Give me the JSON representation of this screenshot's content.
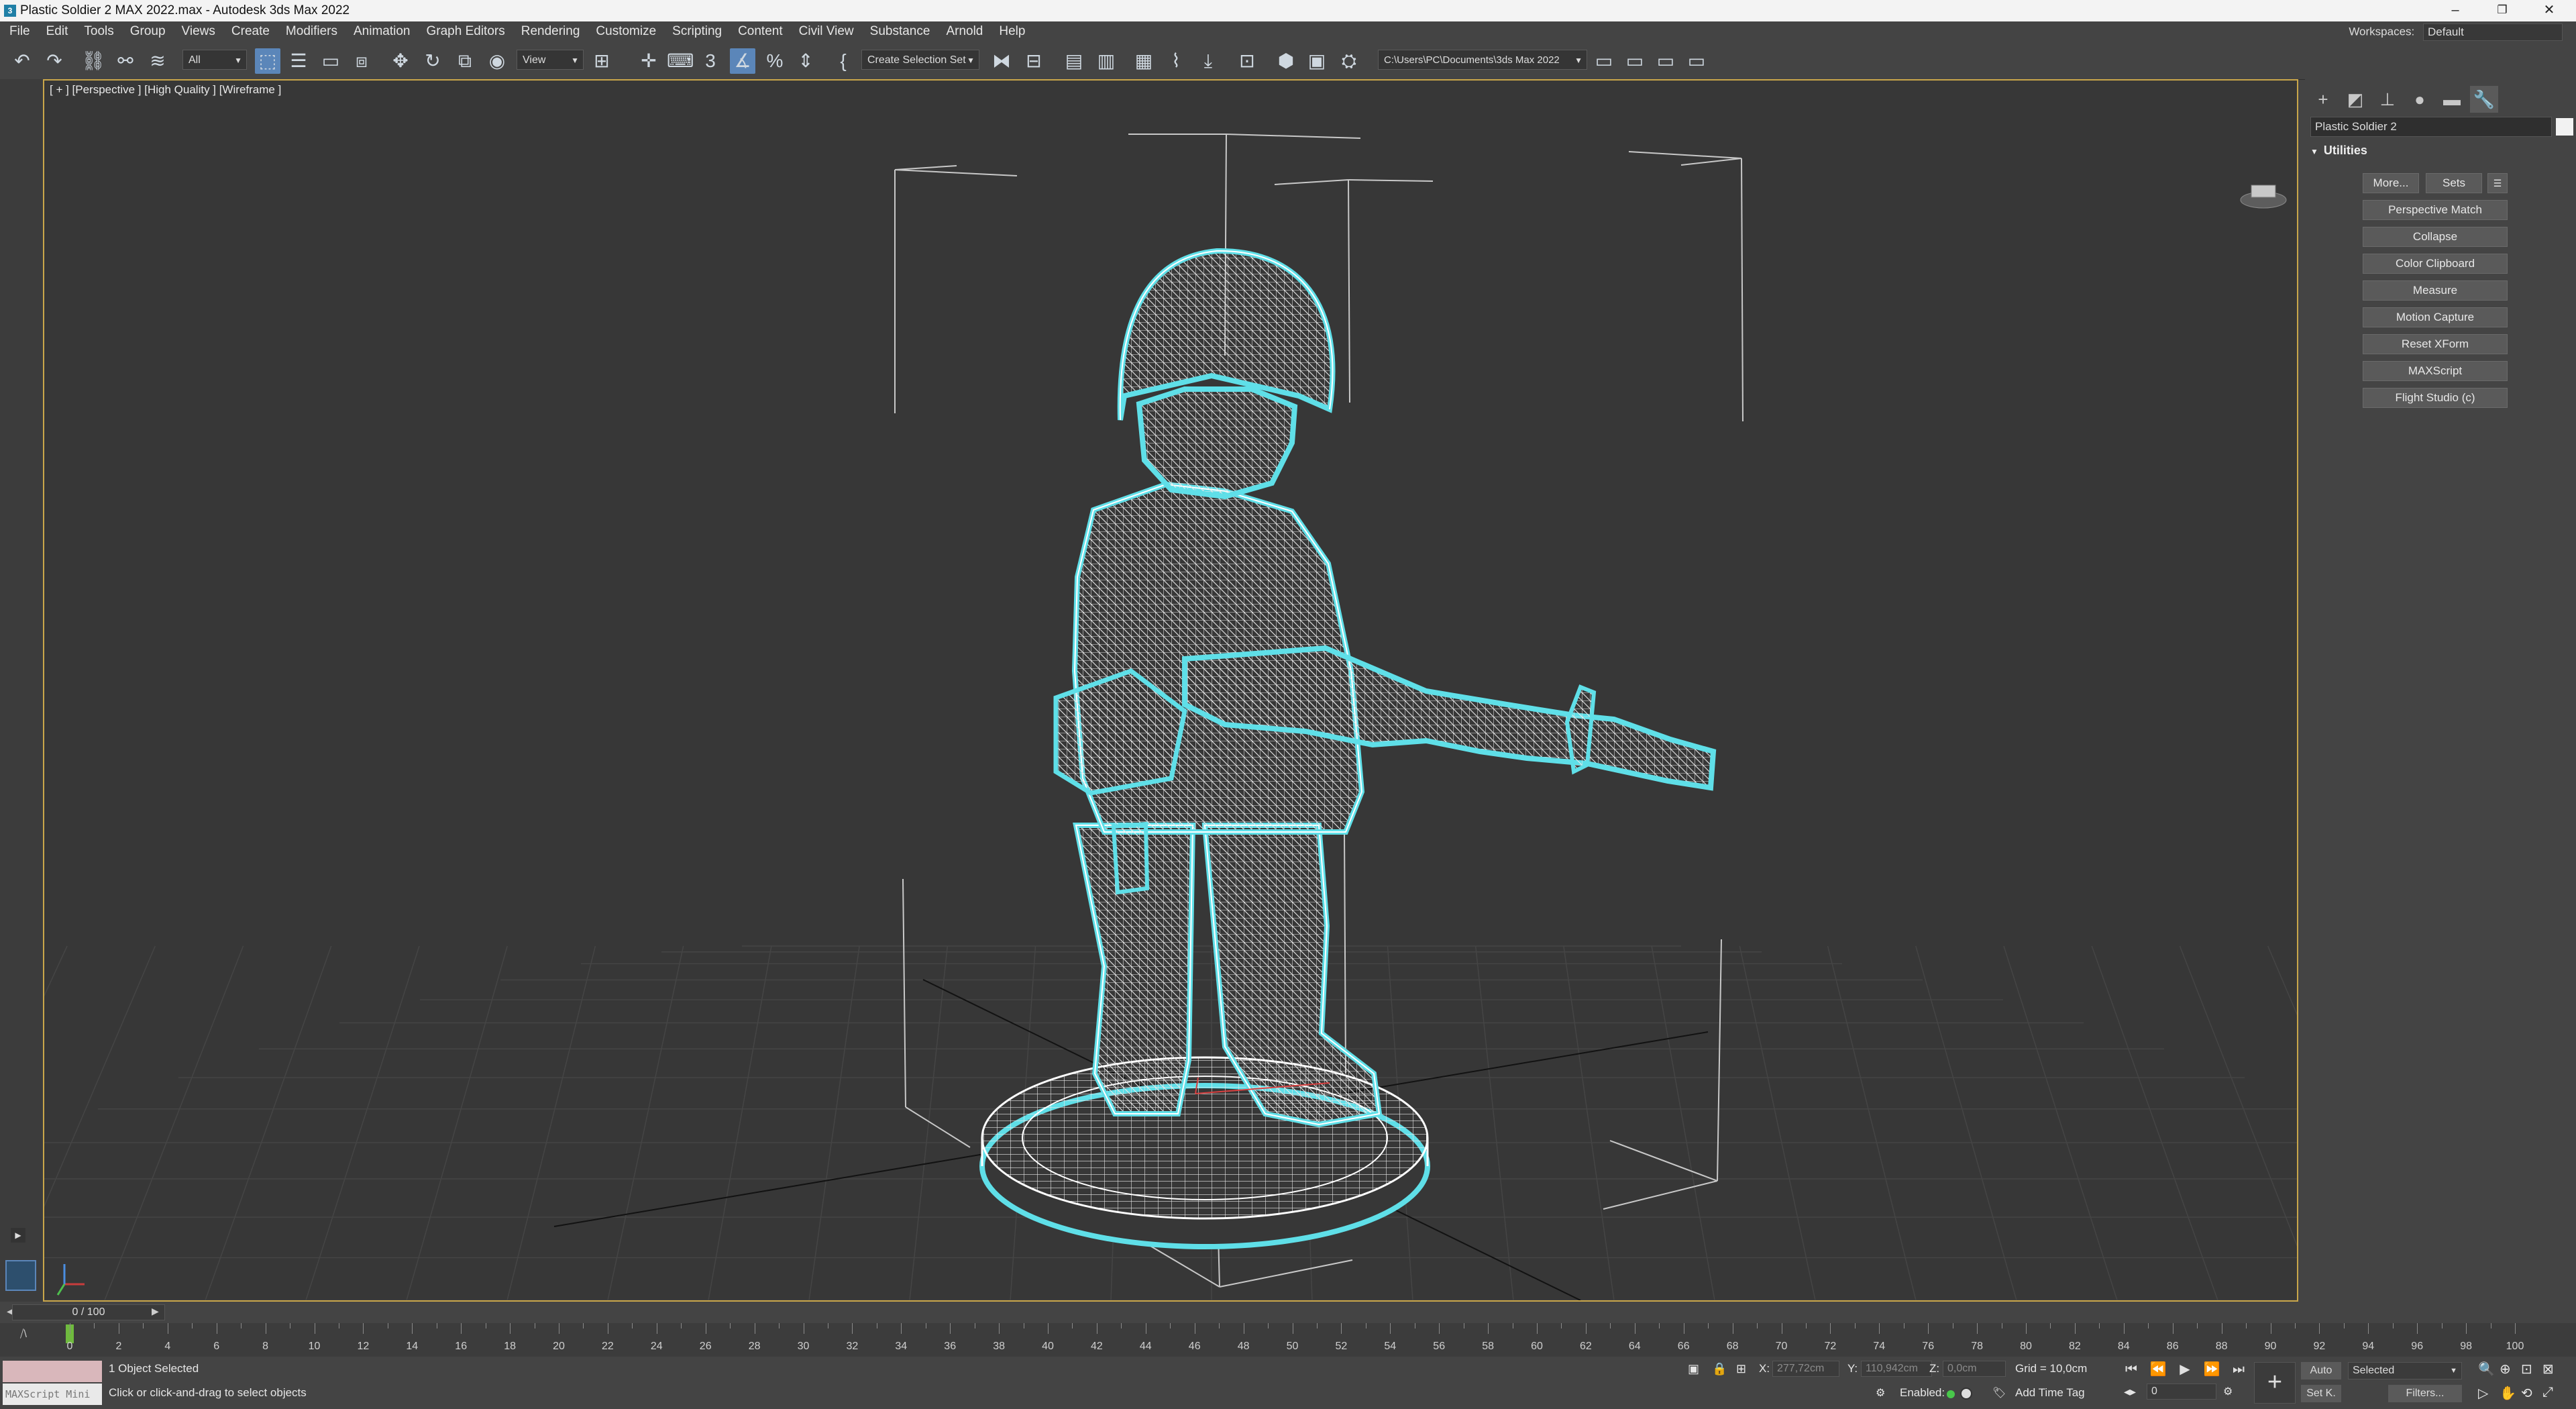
{
  "window": {
    "title": "Plastic Soldier 2 MAX 2022.max - Autodesk 3ds Max 2022",
    "minimize": "–",
    "restore": "❐",
    "close": "✕"
  },
  "menu": {
    "items": [
      "File",
      "Edit",
      "Tools",
      "Group",
      "Views",
      "Create",
      "Modifiers",
      "Animation",
      "Graph Editors",
      "Rendering",
      "Customize",
      "Scripting",
      "Content",
      "Civil View",
      "Substance",
      "Arnold",
      "Help"
    ],
    "workspaces_label": "Workspaces:",
    "workspaces_value": "Default"
  },
  "toolbar": {
    "selection_filter": "All",
    "ref_coord": "View",
    "named_selection": "Create Selection Set",
    "project_path": "C:\\Users\\PC\\Documents\\3ds Max 2022"
  },
  "viewport": {
    "label": "[ + ] [Perspective ] [High Quality ] [Wireframe ]",
    "selection_color": "#5fdfe8",
    "wire_color": "#ffffff"
  },
  "command_panel": {
    "object_name": "Plastic Soldier 2",
    "rollout_title": "Utilities",
    "more_button": "More...",
    "sets_button": "Sets",
    "utilities": [
      "Perspective Match",
      "Collapse",
      "Color Clipboard",
      "Measure",
      "Motion Capture",
      "Reset XForm",
      "MAXScript",
      "Flight Studio (c)"
    ]
  },
  "timeline": {
    "frame_display": "0 / 100",
    "ruler_labels": [
      "0",
      "2",
      "4",
      "6",
      "8",
      "10",
      "12",
      "14",
      "16",
      "18",
      "20",
      "22",
      "24",
      "26",
      "28",
      "30",
      "32",
      "34",
      "36",
      "38",
      "40",
      "42",
      "44",
      "46",
      "48",
      "50",
      "52",
      "54",
      "56",
      "58",
      "60",
      "62",
      "64",
      "66",
      "68",
      "70",
      "72",
      "74",
      "76",
      "78",
      "80",
      "82",
      "84",
      "86",
      "88",
      "90",
      "92",
      "94",
      "96",
      "98",
      "100"
    ]
  },
  "status": {
    "maxscript_placeholder": "MAXScript Mini",
    "selection_count": "1 Object Selected",
    "prompt": "Click or click-and-drag to select objects",
    "x_label": "X:",
    "x_value": "277,72cm",
    "y_label": "Y:",
    "y_value": "110,942cm",
    "z_label": "Z:",
    "z_value": "0,0cm",
    "grid": "Grid = 10,0cm",
    "enabled_label": "Enabled:",
    "add_time_tag": "Add Time Tag",
    "auto_key": "Auto",
    "set_key": "Set K.",
    "key_filter": "Selected",
    "filters": "Filters...",
    "current_frame": "0"
  }
}
